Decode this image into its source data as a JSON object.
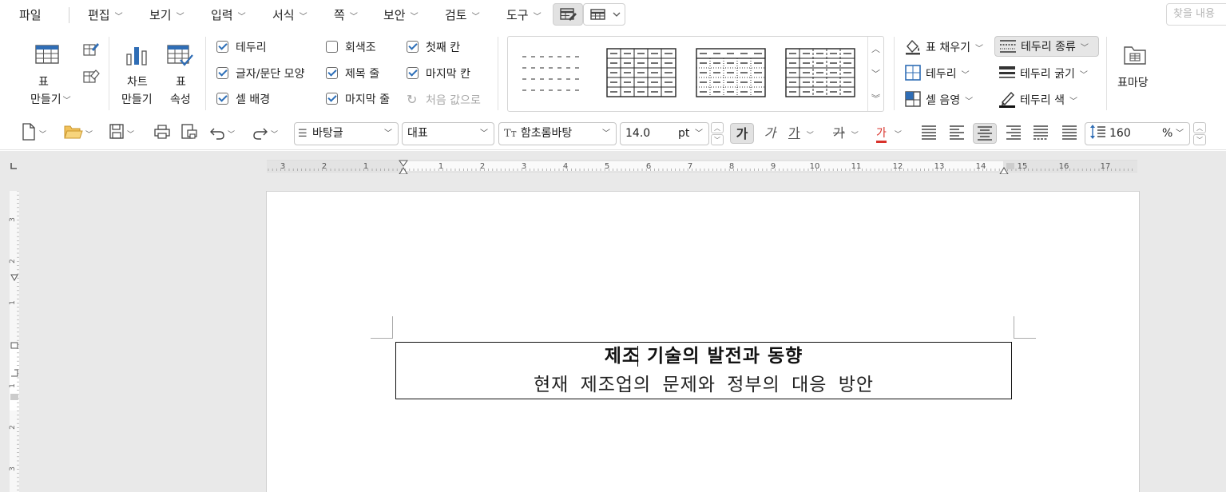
{
  "menubar": {
    "items": [
      {
        "label": "파일",
        "has_arrow": false
      },
      {
        "label": "편집",
        "has_arrow": true
      },
      {
        "label": "보기",
        "has_arrow": true
      },
      {
        "label": "입력",
        "has_arrow": true
      },
      {
        "label": "서식",
        "has_arrow": true
      },
      {
        "label": "쪽",
        "has_arrow": true
      },
      {
        "label": "보안",
        "has_arrow": true
      },
      {
        "label": "검토",
        "has_arrow": true
      },
      {
        "label": "도구",
        "has_arrow": true
      }
    ],
    "find_placeholder": "찾을 내용"
  },
  "ribbon": {
    "make_table": {
      "line1": "표",
      "line2": "만들기"
    },
    "make_chart": {
      "line1": "차트",
      "line2": "만들기"
    },
    "table_props": {
      "line1": "표",
      "line2": "속성"
    },
    "checks": [
      {
        "label": "테두리",
        "checked": true
      },
      {
        "label": "글자/문단 모양",
        "checked": true
      },
      {
        "label": "셀 배경",
        "checked": true
      },
      {
        "label": "회색조",
        "checked": false
      },
      {
        "label": "제목 줄",
        "checked": true
      },
      {
        "label": "마지막 줄",
        "checked": true
      },
      {
        "label": "첫째 칸",
        "checked": true
      },
      {
        "label": "마지막 칸",
        "checked": true
      }
    ],
    "reset_label": "처음 값으로",
    "fill_label": "표 채우기",
    "border_label": "테두리",
    "cell_shade_label": "셀 음영",
    "border_type_label": "테두리 종류",
    "border_width_label": "테두리 굵기",
    "border_color_label": "테두리 색",
    "table_madang_label": "표마당"
  },
  "format_bar": {
    "style_value": "바탕글",
    "lang_value": "대표",
    "font_value": "함초롬바탕",
    "size_value": "14.0",
    "size_unit": "pt",
    "bold_glyph": "가",
    "italic_glyph": "가",
    "underline_glyph": "가",
    "strike_glyph": "가",
    "color_glyph": "가",
    "line_spacing_value": "160",
    "line_spacing_unit": "%"
  },
  "ruler": {
    "h_labels": [
      "3",
      "2",
      "1",
      "1",
      "2",
      "3",
      "4",
      "5",
      "6",
      "7",
      "8",
      "9",
      "10",
      "11",
      "12",
      "13",
      "14",
      "15",
      "16",
      "17"
    ],
    "v_labels": [
      "3",
      "2",
      "1",
      "1",
      "2",
      "3"
    ]
  },
  "document": {
    "title": "제조 기술의 발전과 동향",
    "subtitle": "현재 제조업의 문제와 정부의 대응 방안"
  },
  "colors": {
    "check_accent": "#2d6fb8",
    "font_color_red": "#d9322b",
    "icon_blue": "#2f6db5"
  }
}
